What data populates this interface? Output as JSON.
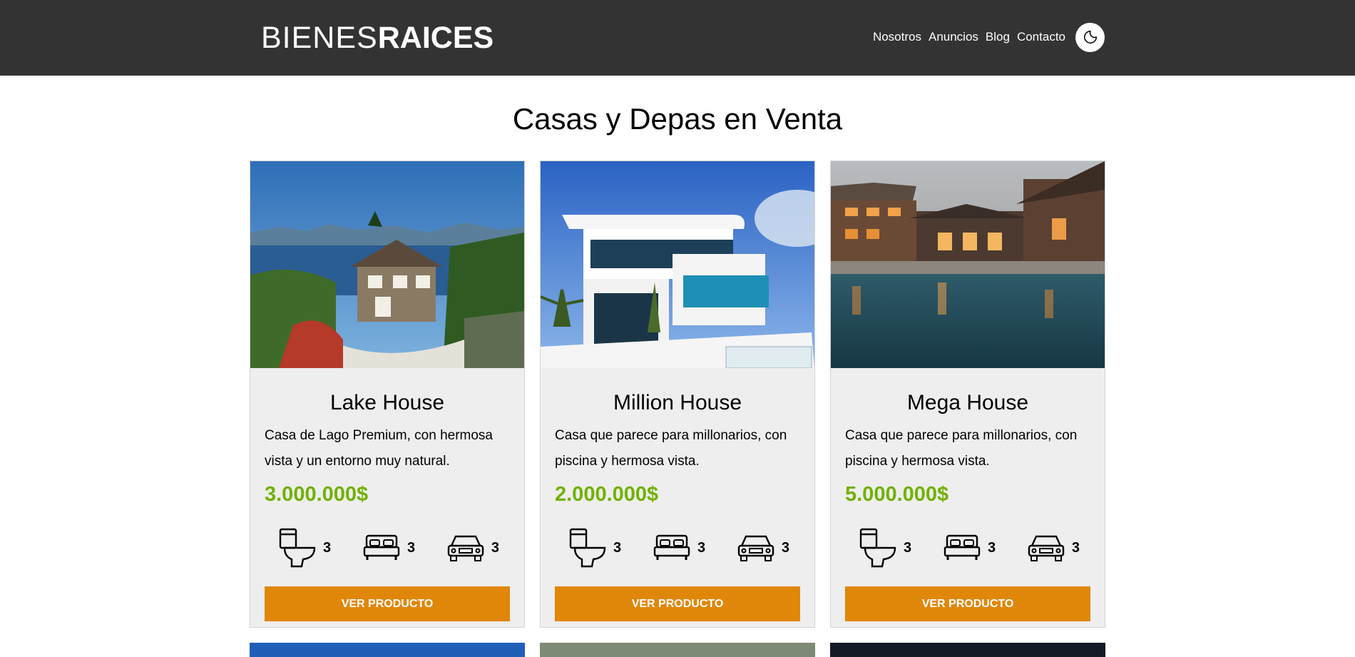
{
  "header": {
    "logo_light": "BIENES",
    "logo_bold": "RAICES",
    "nav": [
      "Nosotros",
      "Anuncios",
      "Blog",
      "Contacto"
    ],
    "toggle_icon": "moon-icon",
    "background": "#333333"
  },
  "section": {
    "title": "Casas y Depas en Venta"
  },
  "cards": [
    {
      "title": "Lake House",
      "description": "Casa de Lago Premium, con hermosa vista y un entorno muy natural.",
      "price": "3.000.000$",
      "wc": "3",
      "bedrooms": "3",
      "parking": "3",
      "button": "VER PRODUCTO"
    },
    {
      "title": "Million House",
      "description": "Casa que parece para millonarios, con piscina y hermosa vista.",
      "price": "2.000.000$",
      "wc": "3",
      "bedrooms": "3",
      "parking": "3",
      "button": "VER PRODUCTO"
    },
    {
      "title": "Mega House",
      "description": "Casa que parece para millonarios, con piscina y hermosa vista.",
      "price": "5.000.000$",
      "wc": "3",
      "bedrooms": "3",
      "parking": "3",
      "button": "VER PRODUCTO"
    }
  ],
  "colors": {
    "accent_price": "#71b100",
    "button": "#e08709",
    "card_bg": "#eeeeee"
  },
  "icons": [
    "toilet-icon",
    "bed-icon",
    "car-icon"
  ]
}
